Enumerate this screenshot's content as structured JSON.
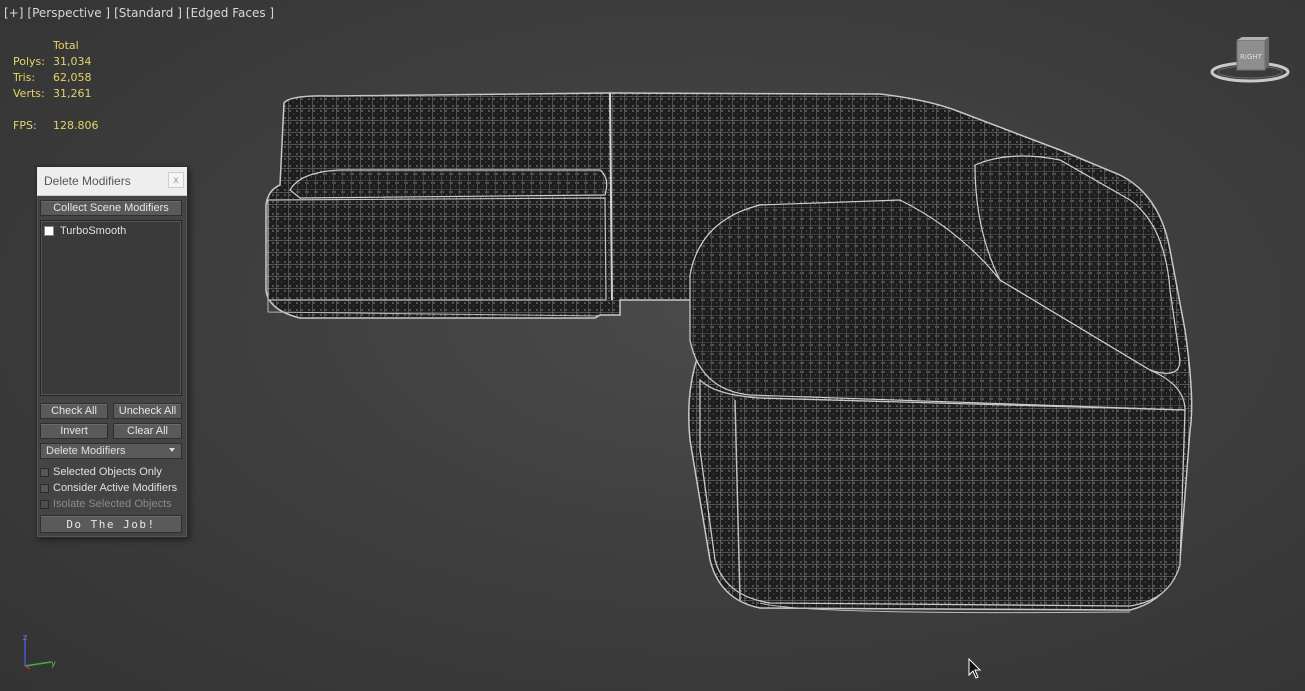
{
  "viewport": {
    "label_plus": "[+]",
    "label_view": "[Perspective ]",
    "label_shading": "[Standard ]",
    "label_mode": "[Edged Faces ]"
  },
  "stats": {
    "header": "Total",
    "polys_label": "Polys:",
    "polys": "31,034",
    "tris_label": "Tris:",
    "tris": "62,058",
    "verts_label": "Verts:",
    "verts": "31,261",
    "fps_label": "FPS:",
    "fps": "128.806"
  },
  "viewcube": {
    "face_label": "RIGHT"
  },
  "axis": {
    "z": "z",
    "y": "y"
  },
  "dialog": {
    "title": "Delete Modifiers",
    "close": "x",
    "collect_btn": "Collect Scene Modifiers",
    "list": [
      {
        "label": "TurboSmooth",
        "checked": false
      }
    ],
    "check_all": "Check All",
    "uncheck_all": "Uncheck All",
    "invert": "Invert",
    "clear_all": "Clear All",
    "mode_select": "Delete Modifiers",
    "opt_selected_only": "Selected Objects Only",
    "opt_consider_active": "Consider Active Modifiers",
    "opt_isolate": "Isolate Selected Objects",
    "do_job": "Do The Job!"
  },
  "colors": {
    "stats_text": "#e6d36a",
    "background": "#3f3f3f",
    "wire": "#bdbdbd",
    "mesh_fill": "#1d1d1d"
  }
}
